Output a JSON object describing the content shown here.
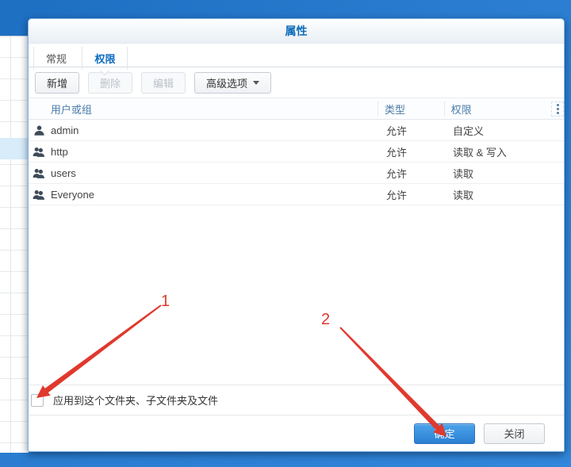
{
  "window": {
    "title": "属性"
  },
  "tabs": [
    {
      "label": "常规",
      "active": false
    },
    {
      "label": "权限",
      "active": true
    }
  ],
  "toolbar": {
    "buttons": [
      {
        "label": "新增",
        "enabled": true
      },
      {
        "label": "删除",
        "enabled": false
      },
      {
        "label": "编辑",
        "enabled": false
      },
      {
        "label": "高级选项",
        "enabled": true,
        "dropdown": true
      }
    ]
  },
  "table": {
    "columns": [
      {
        "label": "用户或组"
      },
      {
        "label": "类型"
      },
      {
        "label": "权限"
      }
    ],
    "header_menu_icon": "vertical-dots",
    "rows": [
      {
        "icon": "user",
        "name": "admin",
        "type": "允许",
        "permission": "自定义"
      },
      {
        "icon": "group",
        "name": "http",
        "type": "允许",
        "permission": "读取 & 写入"
      },
      {
        "icon": "group",
        "name": "users",
        "type": "允许",
        "permission": "读取"
      },
      {
        "icon": "group",
        "name": "Everyone",
        "type": "允许",
        "permission": "读取"
      }
    ]
  },
  "apply_row": {
    "label": "应用到这个文件夹、子文件夹及文件",
    "checked": false
  },
  "footer": {
    "buttons": [
      {
        "label": "确定",
        "style": "primary"
      },
      {
        "label": "关闭",
        "style": "secondary"
      }
    ]
  },
  "annotations": [
    {
      "label": "1",
      "target": "apply-checkbox"
    },
    {
      "label": "2",
      "target": "ok-button"
    }
  ],
  "colors": {
    "desktop_blue": "#2a7cd0",
    "title_blue": "#0e6cbb",
    "accent_blue": "#2b80d3",
    "table_header_text": "#4b7dab",
    "annotation_red": "#e0392e",
    "selected_row_bg": "#d8ecfa",
    "icon_slate": "#3e4b59"
  }
}
